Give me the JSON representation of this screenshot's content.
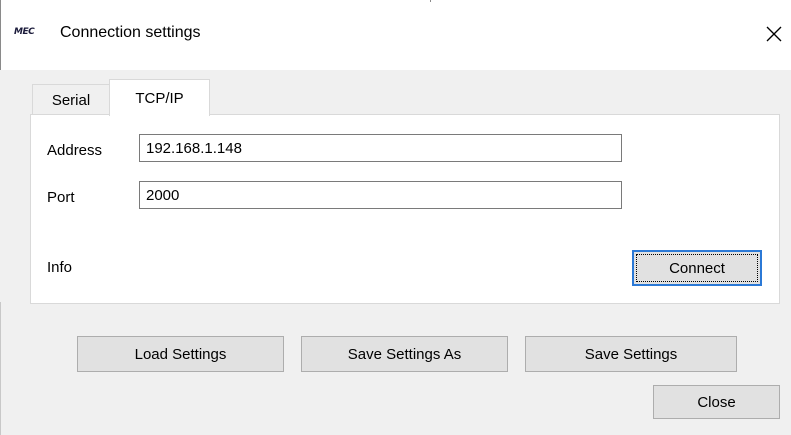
{
  "window": {
    "logo_text": "MEC",
    "title": "Connection settings",
    "close_glyph": "✕"
  },
  "tabs": [
    {
      "label": "Serial",
      "selected": false
    },
    {
      "label": "TCP/IP",
      "selected": true
    }
  ],
  "tcp_panel": {
    "address_label": "Address",
    "address_value": "192.168.1.148",
    "port_label": "Port",
    "port_value": "2000",
    "info_label": "Info",
    "connect_label": "Connect"
  },
  "actions": {
    "load_label": "Load Settings",
    "save_as_label": "Save Settings As",
    "save_label": "Save Settings",
    "close_label": "Close"
  },
  "colors": {
    "dialog_bg": "#f0f0f0",
    "panel_bg": "#ffffff",
    "button_bg": "#e1e1e1",
    "default_button_border": "#2b79d6"
  },
  "icons": {
    "app": "mec-logo-icon",
    "close": "close-icon"
  }
}
